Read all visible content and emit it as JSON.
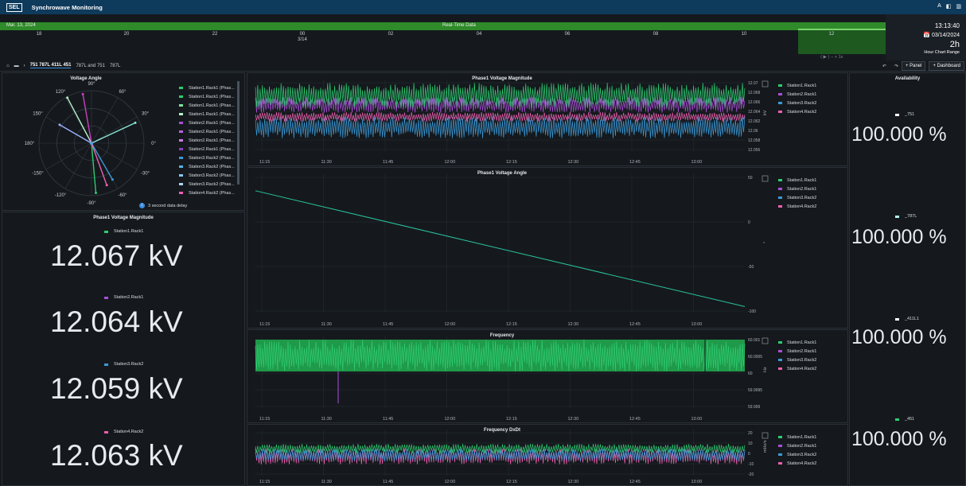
{
  "app": {
    "logo": "SEL",
    "title": "Synchrowave Monitoring",
    "icons": [
      "A",
      "◧",
      "▥"
    ]
  },
  "timeline": {
    "date": "Mar. 13, 2024",
    "label": "Real-Time Data",
    "ticks": [
      "18",
      "20",
      "22",
      "00\n3/14",
      "02",
      "04",
      "06",
      "08",
      "10",
      "12"
    ],
    "nav": "⟨ ▶ ⟩  − + 1x"
  },
  "clock": {
    "time": "13:13:40",
    "date": "📅 03/14/2024",
    "range": "2h",
    "range_label": "Hour Chart Range"
  },
  "breadcrumb": {
    "items": [
      "751 787L 411L 451",
      "787L and 751",
      "787L"
    ]
  },
  "toolbar": {
    "panel": "+ Panel",
    "dashboard": "+ Dashboard",
    "undo": "↶",
    "redo": "↷"
  },
  "polar": {
    "title": "Voltage Angle",
    "angles": [
      "90°",
      "60°",
      "30°",
      "0°",
      "-30°",
      "-60°",
      "-90°",
      "-120°",
      "-150°",
      "180°",
      "150°",
      "120°"
    ],
    "legend": [
      "Station1.Rack1 (Phas...",
      "Station1.Rack1 (Phas...",
      "Station1.Rack1 (Phas...",
      "Station1.Rack1 (Phas...",
      "Station2.Rack1 (Phas...",
      "Station2.Rack1 (Phas...",
      "Station2.Rack1 (Phas...",
      "Station2.Rack1 (Phas...",
      "Station3.Rack2 (Phas...",
      "Station3.Rack2 (Phas...",
      "Station3.Rack2 (Phas...",
      "Station3.Rack2 (Phas...",
      "Station4.Rack2 (Phas..."
    ],
    "legend_colors": [
      "#2ecc71",
      "#2ecc71",
      "#7fe3a0",
      "#b5f0c8",
      "#a94fd6",
      "#b562e0",
      "#cc7ee6",
      "#8a3fc0",
      "#3a9ad9",
      "#5bb0e6",
      "#86c7ef",
      "#aad6f3",
      "#ee5fb0"
    ],
    "delay": "3 second data delay",
    "vectors": [
      {
        "ang": 118,
        "mag": 0.98,
        "color": "#b5f0c8"
      },
      {
        "ang": 100,
        "mag": 0.95,
        "color": "#cc3fc0"
      },
      {
        "ang": 25,
        "mag": 0.92,
        "color": "#8ce6d8"
      },
      {
        "ang": 150,
        "mag": 0.7,
        "color": "#9ab0ff"
      },
      {
        "ang": -85,
        "mag": 0.95,
        "color": "#2ecc71"
      },
      {
        "ang": -60,
        "mag": 0.8,
        "color": "#3a9ad9"
      },
      {
        "ang": -70,
        "mag": 0.85,
        "color": "#ee5fb0"
      }
    ]
  },
  "magnitude": {
    "title": "Phase1 Voltage Magnitude",
    "items": [
      {
        "name": "Station1.Rack1",
        "value": "12.067 kV",
        "color": "#2ecc71"
      },
      {
        "name": "Station2.Rack1",
        "value": "12.064 kV",
        "color": "#a94fd6"
      },
      {
        "name": "Station3.Rack2",
        "value": "12.059 kV",
        "color": "#3a9ad9"
      },
      {
        "name": "Station4.Rack2",
        "value": "12.063 kV",
        "color": "#ee5fb0"
      }
    ]
  },
  "series_names": [
    "Station1.Rack1",
    "Station2.Rack1",
    "Station3.Rack2",
    "Station4.Rack2"
  ],
  "series_colors": [
    "#2ecc71",
    "#a94fd6",
    "#3a9ad9",
    "#ee5fb0"
  ],
  "xticks": [
    "11:15",
    "11:30",
    "11:45",
    "12:00",
    "12:15",
    "12:30",
    "12:45",
    "13:00"
  ],
  "charts": {
    "mag": {
      "title": "Phase1 Voltage Magnitude",
      "ylabel": "kV",
      "yticks": [
        "12.07",
        "12.068",
        "12.066",
        "12.064",
        "12.062",
        "12.06",
        "12.058",
        "12.056"
      ]
    },
    "ang": {
      "title": "Phase1 Voltage Angle",
      "ylabel": "°",
      "yticks": [
        "50",
        "0",
        "-50",
        "-100"
      ]
    },
    "freq": {
      "title": "Frequency",
      "ylabel": "Hz",
      "yticks": [
        "60.001",
        "60.0005",
        "60",
        "59.9995",
        "59.999"
      ]
    },
    "dxdt": {
      "title": "Frequency DxDt",
      "ylabel": "mHz/s",
      "yticks": [
        "20",
        "10",
        "0",
        "-10",
        "-20"
      ]
    }
  },
  "chart_data": [
    {
      "type": "line",
      "title": "Phase1 Voltage Angle",
      "ylabel": "°",
      "ylim": [
        -100,
        50
      ],
      "x": [
        "11:15",
        "13:10"
      ],
      "series": [
        {
          "name": "Station1.Rack1",
          "values": [
            35,
            -95
          ]
        }
      ]
    }
  ],
  "availability": {
    "title": "Availability",
    "items": [
      {
        "name": "_751",
        "value": "100.000 %",
        "color": "#ffffff"
      },
      {
        "name": "_787L",
        "value": "100.000 %",
        "color": "#b5f0e8"
      },
      {
        "name": "_411L1",
        "value": "100.000 %",
        "color": "#ffffff"
      },
      {
        "name": "_451",
        "value": "100.000 %",
        "color": "#2ecc71"
      }
    ]
  }
}
